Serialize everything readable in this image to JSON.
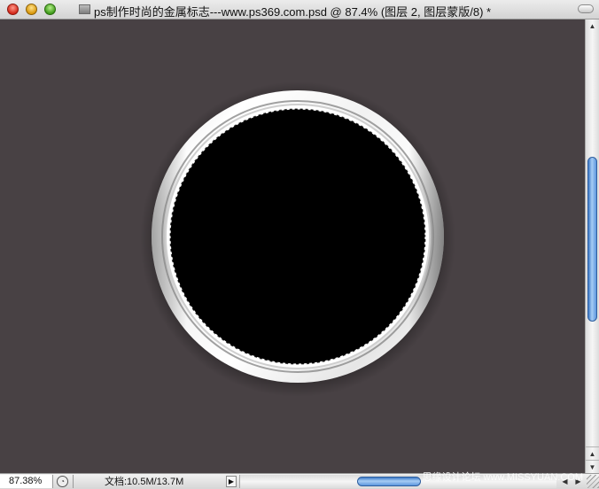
{
  "window": {
    "title": "ps制作时尚的金属标志---www.ps369.com.psd @ 87.4% (图层 2, 图层蒙版/8) *",
    "buttons": {
      "close": "close-window",
      "minimize": "minimize-window",
      "maximize": "zoom-window"
    }
  },
  "canvas": {
    "background_color": "#484144",
    "ring_color": "#ffffff",
    "inner_fill": "#000000",
    "selection": "marching-ants-circle"
  },
  "statusbar": {
    "zoom_value": "87.38%",
    "doc_info": "文档:10.5M/13.7M",
    "menu_arrow": "▶"
  },
  "scrollbars": {
    "vertical_up": "▲",
    "vertical_down": "▼",
    "horizontal_left": "◀",
    "horizontal_right": "▶"
  },
  "watermark": {
    "text": "思缘设计论坛 www.MISSYUAN.COM"
  },
  "icons": {
    "doc_proxy": "document-proxy-icon",
    "zoom_toggle": "zoom-percentage-icon"
  }
}
